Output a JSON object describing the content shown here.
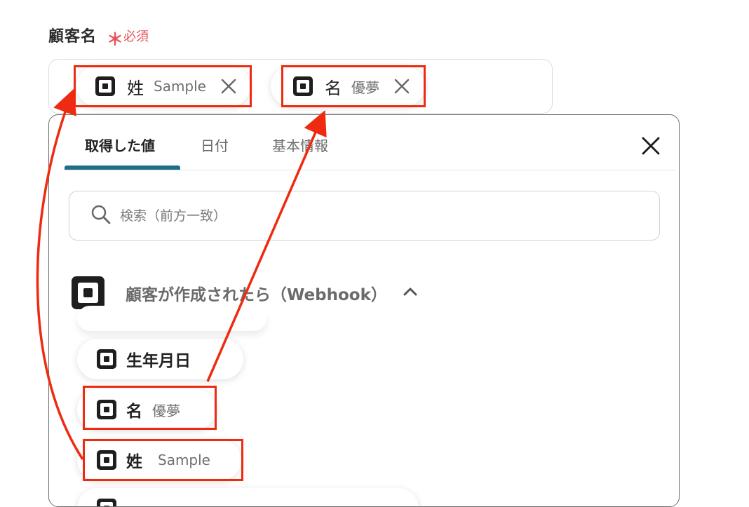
{
  "field": {
    "label": "顧客名",
    "required_mark": "＊",
    "required_text": "必須"
  },
  "selected_tokens": [
    {
      "name": "姓",
      "value": "Sample"
    },
    {
      "name": "名",
      "value": "優夢"
    }
  ],
  "picker": {
    "tabs": [
      {
        "label": "取得した値",
        "active": true
      },
      {
        "label": "日付",
        "active": false
      },
      {
        "label": "基本情報",
        "active": false
      }
    ],
    "search": {
      "placeholder": "検索（前方一致）",
      "value": ""
    },
    "section": {
      "title": "顧客が作成されたら（Webhook）",
      "expanded": true
    },
    "items": [
      {
        "name": "生年月日",
        "value": ""
      },
      {
        "name": "名",
        "value": "優夢"
      },
      {
        "name": "姓",
        "value": "Sample"
      }
    ]
  },
  "colors": {
    "accent": "#1f6e86",
    "required": "#e8525a",
    "highlight": "#ee2b10"
  }
}
